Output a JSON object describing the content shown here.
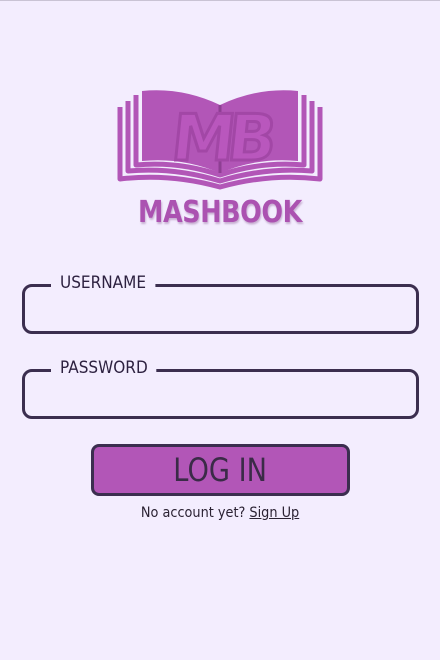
{
  "app": {
    "logo_monogram": "MB",
    "brand_name": "MASHBOOK"
  },
  "login_form": {
    "username_label": "USERNAME",
    "username_value": "",
    "password_label": "PASSWORD",
    "password_value": "",
    "login_button_label": "LOG IN",
    "signup_prompt": "No account yet?",
    "signup_link_label": "Sign Up"
  },
  "colors": {
    "background": "#f3edfe",
    "accent": "#b256b7",
    "outline": "#3b2e4f"
  },
  "icons": {
    "logo": "open-book-icon"
  }
}
